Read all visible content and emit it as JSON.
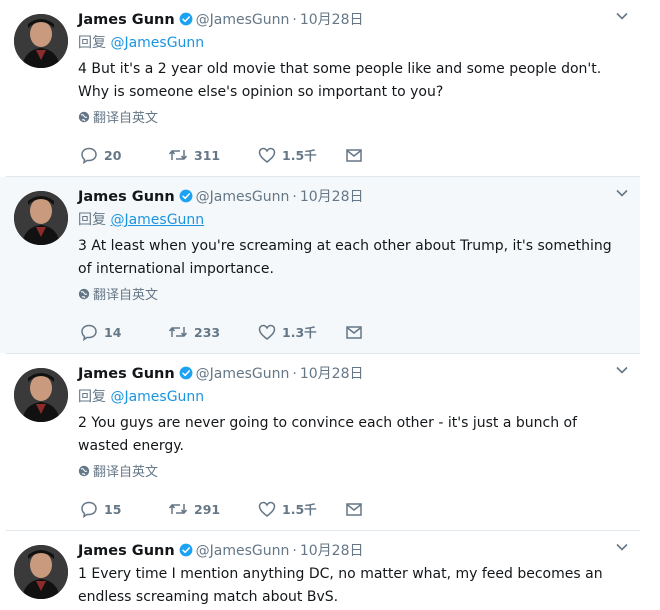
{
  "author": {
    "name": "James Gunn",
    "handle": "@JamesGunn",
    "separator": "·"
  },
  "translate_label": "翻译自英文",
  "reply_prefix": "回复",
  "tweets": [
    {
      "date": "10月28日",
      "reply_to": "@JamesGunn",
      "text": "4 But it's a 2 year old movie that some people like and some people don't. Why is someone else's opinion so important to you?",
      "replies": "20",
      "retweets": "311",
      "likes": "1.5千"
    },
    {
      "date": "10月28日",
      "reply_to": "@JamesGunn",
      "text": "3 At least when you're screaming at each other about Trump, it's something of international importance.",
      "replies": "14",
      "retweets": "233",
      "likes": "1.3千"
    },
    {
      "date": "10月28日",
      "reply_to": "@JamesGunn",
      "text": "2 You guys are never going to convince each other - it's just a bunch of wasted energy.",
      "replies": "15",
      "retweets": "291",
      "likes": "1.5千"
    },
    {
      "date": "10月28日",
      "text": "1 Every time I mention anything DC, no matter what, my feed becomes an endless screaming match about BvS."
    }
  ],
  "colors": {
    "verified": "#1da1f2",
    "mention": "#1b95e0",
    "muted": "#657786",
    "hover_bg": "#f5f8fa"
  }
}
